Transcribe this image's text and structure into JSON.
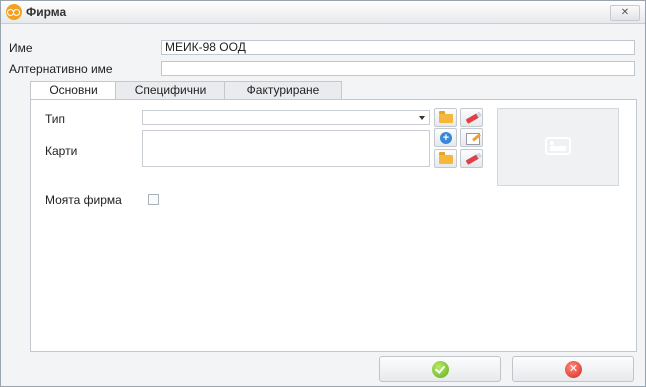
{
  "window": {
    "title": "Фирма",
    "close_glyph": "✕"
  },
  "form": {
    "name_label": "Име",
    "name_value": "МЕИК-98 ООД",
    "alt_name_label": "Алтернативно име",
    "alt_name_value": ""
  },
  "tabs": [
    {
      "label": "Основни",
      "active": true
    },
    {
      "label": "Специфични",
      "active": false
    },
    {
      "label": "Фактуриране",
      "active": false
    }
  ],
  "main_tab": {
    "type_label": "Тип",
    "type_value": "",
    "cards_label": "Карти",
    "my_firm_label": "Моята фирма",
    "my_firm_checked": false
  },
  "icons": {
    "open": "folder-open-icon",
    "clear": "eraser-icon",
    "add": "plus-circle-icon",
    "edit": "edit-icon",
    "image": "image-placeholder-icon",
    "ok": "checkmark-icon",
    "cancel": "x-icon"
  },
  "colors": {
    "accent": "#f2a21e",
    "ok": "#6cbf2a",
    "cancel": "#e0392b"
  },
  "footer": {
    "cancel_glyph": "✕"
  }
}
